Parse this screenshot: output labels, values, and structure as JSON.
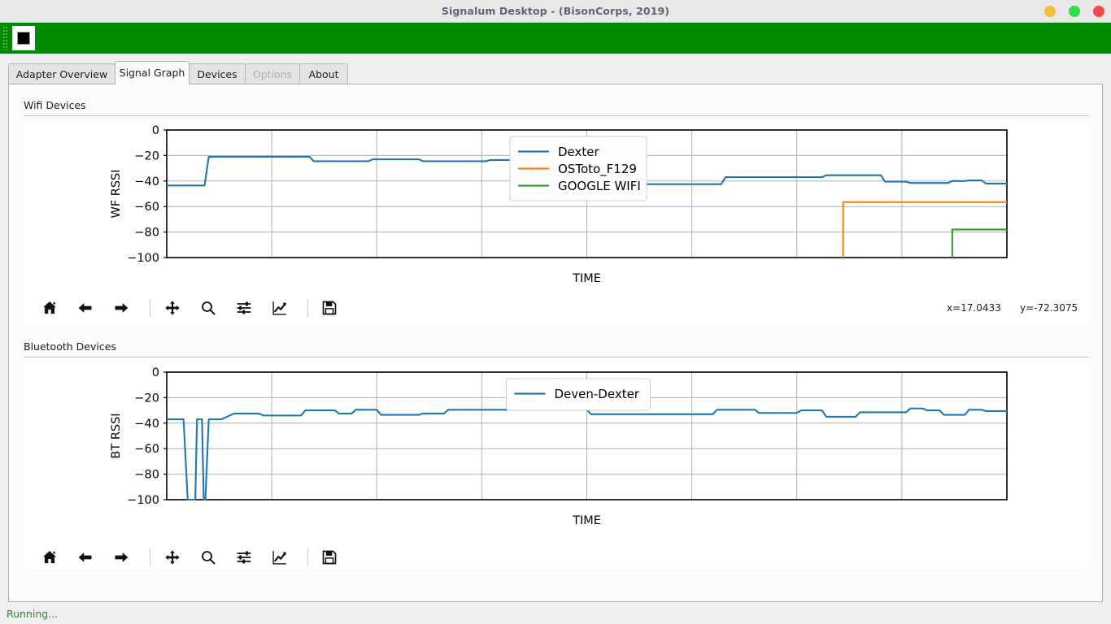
{
  "window": {
    "title": "Signalum Desktop - (BisonCorps, 2019)",
    "controls": [
      {
        "name": "minimize",
        "color": "#f2c138"
      },
      {
        "name": "maximize",
        "color": "#2ee04a"
      },
      {
        "name": "close",
        "color": "#ef4a4f"
      }
    ]
  },
  "toolbar": {
    "background_color": "#008a00",
    "stop_button_label": "stop-square"
  },
  "tabs": [
    {
      "label": "Adapter Overview",
      "active": false,
      "disabled": false
    },
    {
      "label": "Signal Graph",
      "active": true,
      "disabled": false
    },
    {
      "label": "Devices",
      "active": false,
      "disabled": false
    },
    {
      "label": "Options",
      "active": false,
      "disabled": true
    },
    {
      "label": "About",
      "active": false,
      "disabled": false
    }
  ],
  "sections": {
    "wifi": {
      "label": "Wifi Devices"
    },
    "bluetooth": {
      "label": "Bluetooth Devices"
    }
  },
  "navtoolbar": {
    "buttons": [
      {
        "icon": "home-icon",
        "tooltip": "Home"
      },
      {
        "icon": "arrow-left-icon",
        "tooltip": "Back"
      },
      {
        "icon": "arrow-right-icon",
        "tooltip": "Forward"
      },
      {
        "icon": "pan-move-icon",
        "tooltip": "Pan"
      },
      {
        "icon": "magnifier-icon",
        "tooltip": "Zoom"
      },
      {
        "icon": "sliders-icon",
        "tooltip": "Configure subplots"
      },
      {
        "icon": "line-chart-icon",
        "tooltip": "Edit axis"
      },
      {
        "icon": "floppy-save-icon",
        "tooltip": "Save"
      }
    ]
  },
  "wifi_coords": {
    "x": "x=17.0433",
    "y": "y=-72.3075"
  },
  "status": {
    "text": "Running..."
  },
  "colors": {
    "blue": "#1f77b4",
    "orange": "#ff7f0e",
    "green": "#2ca02c",
    "grid": "#b0b0b0",
    "axis": "#000000"
  },
  "chart_data": [
    {
      "type": "line",
      "title": "Wifi Devices",
      "xlabel": "TIME",
      "ylabel": "WF RSSI",
      "ylim": [
        -100,
        0
      ],
      "yticks": [
        0,
        -20,
        -40,
        -60,
        -80,
        -100
      ],
      "ytick_labels": [
        "0",
        "−20",
        "−40",
        "−60",
        "−80",
        "−100"
      ],
      "xlim": [
        0,
        100
      ],
      "xtick_labels": [],
      "grid": true,
      "legend_position": "upper center",
      "series": [
        {
          "name": "Dexter",
          "color": "#1f77b4",
          "x": [
            0,
            3,
            4.5,
            5,
            14,
            14.5,
            17,
            17.5,
            20.5,
            21,
            24,
            24.5,
            27,
            27.5,
            30,
            30.5,
            34,
            34.5,
            38,
            38.5,
            41,
            41.5,
            43,
            43.5,
            47,
            47.5,
            50,
            50.5,
            55,
            55.5,
            60,
            60.5,
            66,
            66.5,
            75,
            75.5,
            78,
            78.5,
            80,
            80.5,
            83,
            83.5,
            85,
            85.5,
            88,
            88.5,
            91,
            91.5,
            93,
            93.5,
            95,
            95.5,
            97,
            97.5,
            100
          ],
          "y": [
            -43.5,
            -43.5,
            -43.5,
            -21,
            -21,
            -21,
            -21,
            -24.5,
            -24.5,
            -24.5,
            -24.5,
            -23,
            -23,
            -23,
            -23,
            -24.5,
            -24.5,
            -24.5,
            -24.5,
            -23.5,
            -23.5,
            -23.5,
            -23.5,
            -35.5,
            -35.5,
            -35.5,
            -35.5,
            -35.5,
            -35.5,
            -42.5,
            -42.5,
            -42.5,
            -42.5,
            -37,
            -37,
            -37,
            -37,
            -35.5,
            -35.5,
            -35.5,
            -35.5,
            -35.5,
            -35.5,
            -40.5,
            -40.5,
            -41.5,
            -41.5,
            -41.5,
            -41.5,
            -40,
            -40,
            -39.5,
            -39.5,
            -42,
            -42
          ]
        },
        {
          "name": "OSToto_F129",
          "color": "#ff7f0e",
          "x": [
            80.5,
            80.5,
            100
          ],
          "y": [
            -100,
            -56.5,
            -56.5
          ]
        },
        {
          "name": "GOOGLE WIFI",
          "color": "#2ca02c",
          "x": [
            93.5,
            93.5,
            100
          ],
          "y": [
            -100,
            -78,
            -78
          ]
        }
      ]
    },
    {
      "type": "line",
      "title": "Bluetooth Devices",
      "xlabel": "TIME",
      "ylabel": "BT RSSI",
      "ylim": [
        -100,
        0
      ],
      "yticks": [
        0,
        -20,
        -40,
        -60,
        -80,
        -100
      ],
      "ytick_labels": [
        "0",
        "−20",
        "−40",
        "−60",
        "−80",
        "−100"
      ],
      "xlim": [
        0,
        100
      ],
      "xtick_labels": [],
      "grid": true,
      "legend_position": "upper center",
      "series": [
        {
          "name": "Deven-Dexter",
          "color": "#1f77b4",
          "x": [
            0,
            1.5,
            2,
            2.5,
            3,
            3.2,
            3.4,
            3.6,
            4,
            4.2,
            4.4,
            4.6,
            5,
            6,
            6.5,
            8,
            8.5,
            11,
            11.5,
            14,
            14.5,
            16,
            16.5,
            18,
            18.5,
            20,
            20.5,
            22,
            22.5,
            25,
            25.5,
            28,
            28.5,
            30,
            30.5,
            33,
            33.5,
            38,
            38.5,
            50,
            50.5,
            56,
            56.5,
            62,
            62.5,
            65,
            65.5,
            68,
            68.5,
            70,
            70.5,
            72,
            72.5,
            75,
            75.5,
            78,
            78.5,
            80,
            80.5,
            82,
            82.5,
            85,
            85.5,
            88,
            88.5,
            90,
            90.5,
            92,
            92.5,
            95,
            95.5,
            97,
            97.5,
            100
          ],
          "y": [
            -37,
            -37,
            -37,
            -100,
            -100,
            -100,
            -100,
            -37,
            -37,
            -37,
            -100,
            -100,
            -37,
            -37,
            -37,
            -32.5,
            -32.5,
            -32.5,
            -34,
            -34,
            -34,
            -34,
            -30,
            -30,
            -30,
            -30,
            -32.5,
            -32.5,
            -29.5,
            -29.5,
            -33.5,
            -33.5,
            -33.5,
            -33.5,
            -32.5,
            -32.5,
            -29.5,
            -29.5,
            -29.5,
            -29.5,
            -33,
            -33,
            -33,
            -33,
            -33,
            -33,
            -29.5,
            -29.5,
            -29.5,
            -29.5,
            -32,
            -32,
            -32,
            -32,
            -30,
            -30,
            -35,
            -35,
            -35,
            -35,
            -31.5,
            -31.5,
            -31.5,
            -31.5,
            -28.5,
            -28.5,
            -30,
            -30,
            -33.5,
            -33.5,
            -29.5,
            -29.5,
            -30.5,
            -30.5
          ]
        }
      ]
    }
  ]
}
